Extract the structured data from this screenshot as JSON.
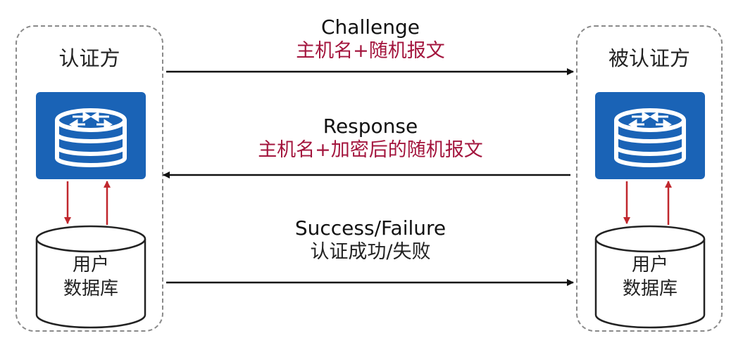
{
  "authenticator": {
    "title": "认证方",
    "db_line1": "用户",
    "db_line2": "数据库"
  },
  "authenticatee": {
    "title": "被认证方",
    "db_line1": "用户",
    "db_line2": "数据库"
  },
  "messages": [
    {
      "en": "Challenge",
      "zh": "主机名+随机报文",
      "direction": "right"
    },
    {
      "en": "Response",
      "zh": "主机名+加密后的随机报文",
      "direction": "left"
    },
    {
      "en": "Success/Failure",
      "zh": "认证成功/失败",
      "direction": "right"
    }
  ],
  "colors": {
    "router": "#1a63b6",
    "red_arrow": "#c0272d",
    "red_text": "#a3153d"
  },
  "icons": [
    "router-icon",
    "database-icon"
  ]
}
